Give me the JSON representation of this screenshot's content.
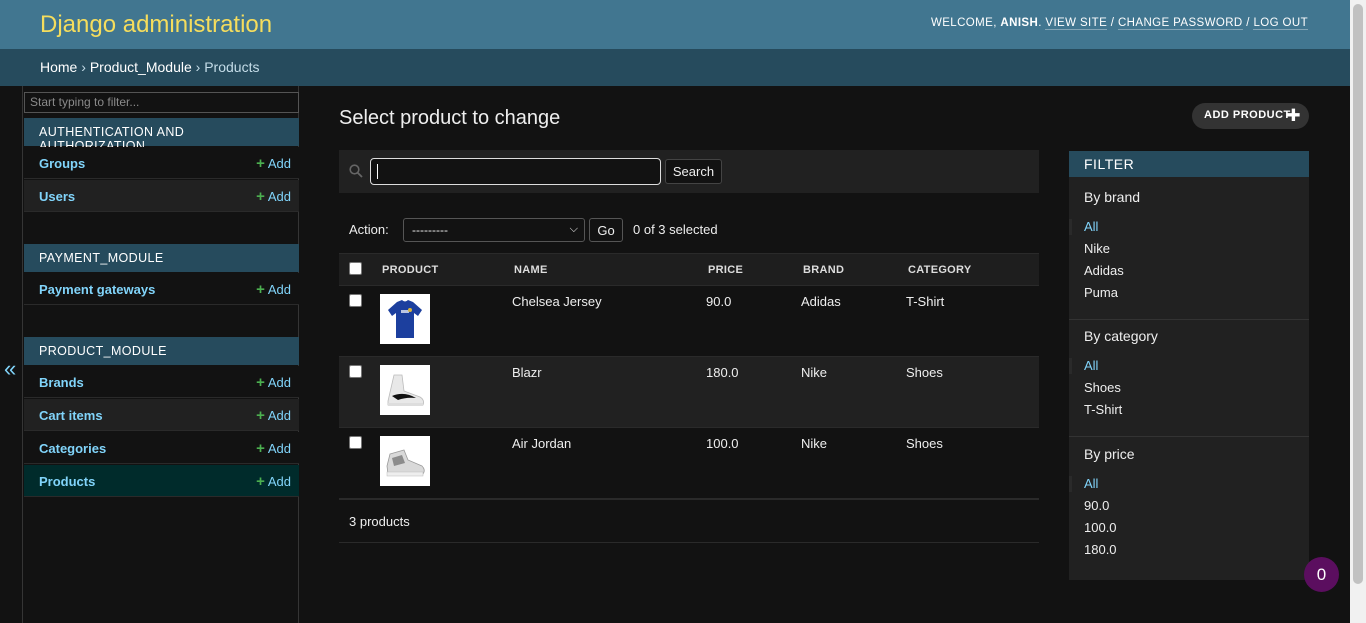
{
  "header": {
    "branding": "Django administration",
    "welcome": "WELCOME,",
    "username": "ANISH",
    "view_site": "VIEW SITE",
    "change_password": "CHANGE PASSWORD",
    "log_out": "LOG OUT",
    "sep": "/"
  },
  "breadcrumbs": {
    "home": "Home",
    "app": "Product_Module",
    "current": "Products",
    "sep": "›"
  },
  "sidebar": {
    "filter_placeholder": "Start typing to filter...",
    "toggle": "«",
    "add_label": "Add",
    "apps": [
      {
        "caption": "AUTHENTICATION AND AUTHORIZATION",
        "models": [
          "Groups",
          "Users"
        ]
      },
      {
        "caption": "PAYMENT_MODULE",
        "models": [
          "Payment gateways"
        ]
      },
      {
        "caption": "PRODUCT_MODULE",
        "models": [
          "Brands",
          "Cart items",
          "Categories",
          "Products"
        ]
      }
    ]
  },
  "main": {
    "title": "Select product to change",
    "add_button": "ADD PRODUCT",
    "search_button": "Search",
    "search_value": "",
    "action_label": "Action:",
    "action_selected": "---------",
    "go_button": "Go",
    "selected_count": "0 of 3 selected",
    "columns": [
      "PRODUCT",
      "NAME",
      "PRICE",
      "BRAND",
      "CATEGORY"
    ],
    "rows": [
      {
        "name": "Chelsea Jersey",
        "price": "90.0",
        "brand": "Adidas",
        "category": "T-Shirt"
      },
      {
        "name": "Blazr",
        "price": "180.0",
        "brand": "Nike",
        "category": "Shoes"
      },
      {
        "name": "Air Jordan",
        "price": "100.0",
        "brand": "Nike",
        "category": "Shoes"
      }
    ],
    "paginator": "3 products"
  },
  "filter": {
    "title": "FILTER",
    "groups": [
      {
        "title": "By brand",
        "options": [
          "All",
          "Nike",
          "Adidas",
          "Puma"
        ]
      },
      {
        "title": "By category",
        "options": [
          "All",
          "Shoes",
          "T-Shirt"
        ]
      },
      {
        "title": "By price",
        "options": [
          "All",
          "90.0",
          "100.0",
          "180.0"
        ]
      }
    ]
  },
  "badge": "0",
  "colors": {
    "header_bg": "#417690",
    "branding": "#f5dd5d",
    "link": "#81d4fa",
    "add_plus": "#4caf50",
    "caption_bg": "#264b5d"
  }
}
